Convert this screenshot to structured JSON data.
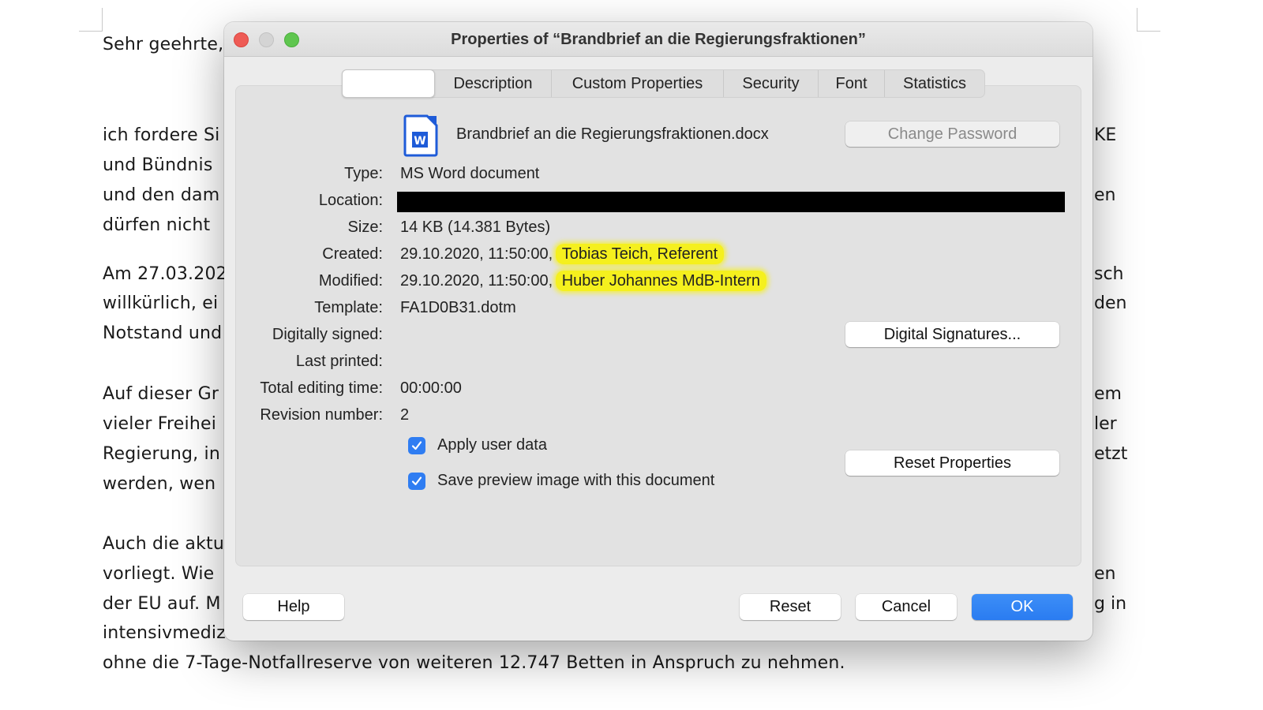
{
  "background_document": {
    "left_fragments": [
      "Sehr geehrte,",
      "ich fordere Si",
      "und Bündnis",
      "und den dam",
      "dürfen nicht",
      "Am 27.03.202",
      "willkürlich, ei",
      "Notstand und",
      "Auf dieser Gr",
      "vieler Freihei",
      "Regierung, in",
      "werden, wen",
      "Auch die aktu",
      "vorliegt. Wie",
      "der EU auf. M",
      "intensivmediz"
    ],
    "right_fragments": [
      "KE",
      "en",
      "sch",
      "den",
      "em",
      "ler",
      "etzt",
      "en",
      "g in"
    ],
    "last_line": "ohne die 7-Tage-Notfallreserve von weiteren 12.747 Betten in Anspruch zu nehmen."
  },
  "dialog": {
    "title": "Properties of “Brandbrief an die Regierungsfraktionen”",
    "tabs": [
      {
        "label": "",
        "active": true
      },
      {
        "label": "Description",
        "active": false
      },
      {
        "label": "Custom Properties",
        "active": false
      },
      {
        "label": "Security",
        "active": false
      },
      {
        "label": "Font",
        "active": false
      },
      {
        "label": "Statistics",
        "active": false
      }
    ],
    "file": {
      "icon": "word-document-icon",
      "icon_letter": "W",
      "name": "Brandbrief an die Regierungsfraktionen.docx"
    },
    "change_password_label": "Change Password",
    "fields": {
      "type": {
        "label": "Type:",
        "value": "MS Word document"
      },
      "location": {
        "label": "Location:",
        "value": "[redacted]"
      },
      "size": {
        "label": "Size:",
        "value": "14 KB (14.381 Bytes)"
      },
      "created": {
        "label": "Created:",
        "date": "29.10.2020, 11:50:00,",
        "author": "Tobias Teich, Referent"
      },
      "modified": {
        "label": "Modified:",
        "date": "29.10.2020, 11:50:00,",
        "author": "Huber Johannes MdB-Intern"
      },
      "template": {
        "label": "Template:",
        "value": "FA1D0B31.dotm"
      },
      "digitally_signed": {
        "label": "Digitally signed:",
        "value": ""
      },
      "last_printed": {
        "label": "Last printed:",
        "value": ""
      },
      "total_editing_time": {
        "label": "Total editing time:",
        "value": "00:00:00"
      },
      "revision_number": {
        "label": "Revision number:",
        "value": "2"
      }
    },
    "digital_signatures_label": "Digital Signatures...",
    "reset_properties_label": "Reset Properties",
    "checkboxes": [
      {
        "label": "Apply user data",
        "checked": true
      },
      {
        "label": "Save preview image with this document",
        "checked": true
      }
    ],
    "footer": {
      "help": "Help",
      "reset": "Reset",
      "cancel": "Cancel",
      "ok": "OK"
    },
    "colors": {
      "highlight": "#f5f01e",
      "primary_button": "#2f7df2",
      "checkbox": "#2f7df2",
      "close": "#ee5b55",
      "maximize": "#5fc64f"
    }
  }
}
